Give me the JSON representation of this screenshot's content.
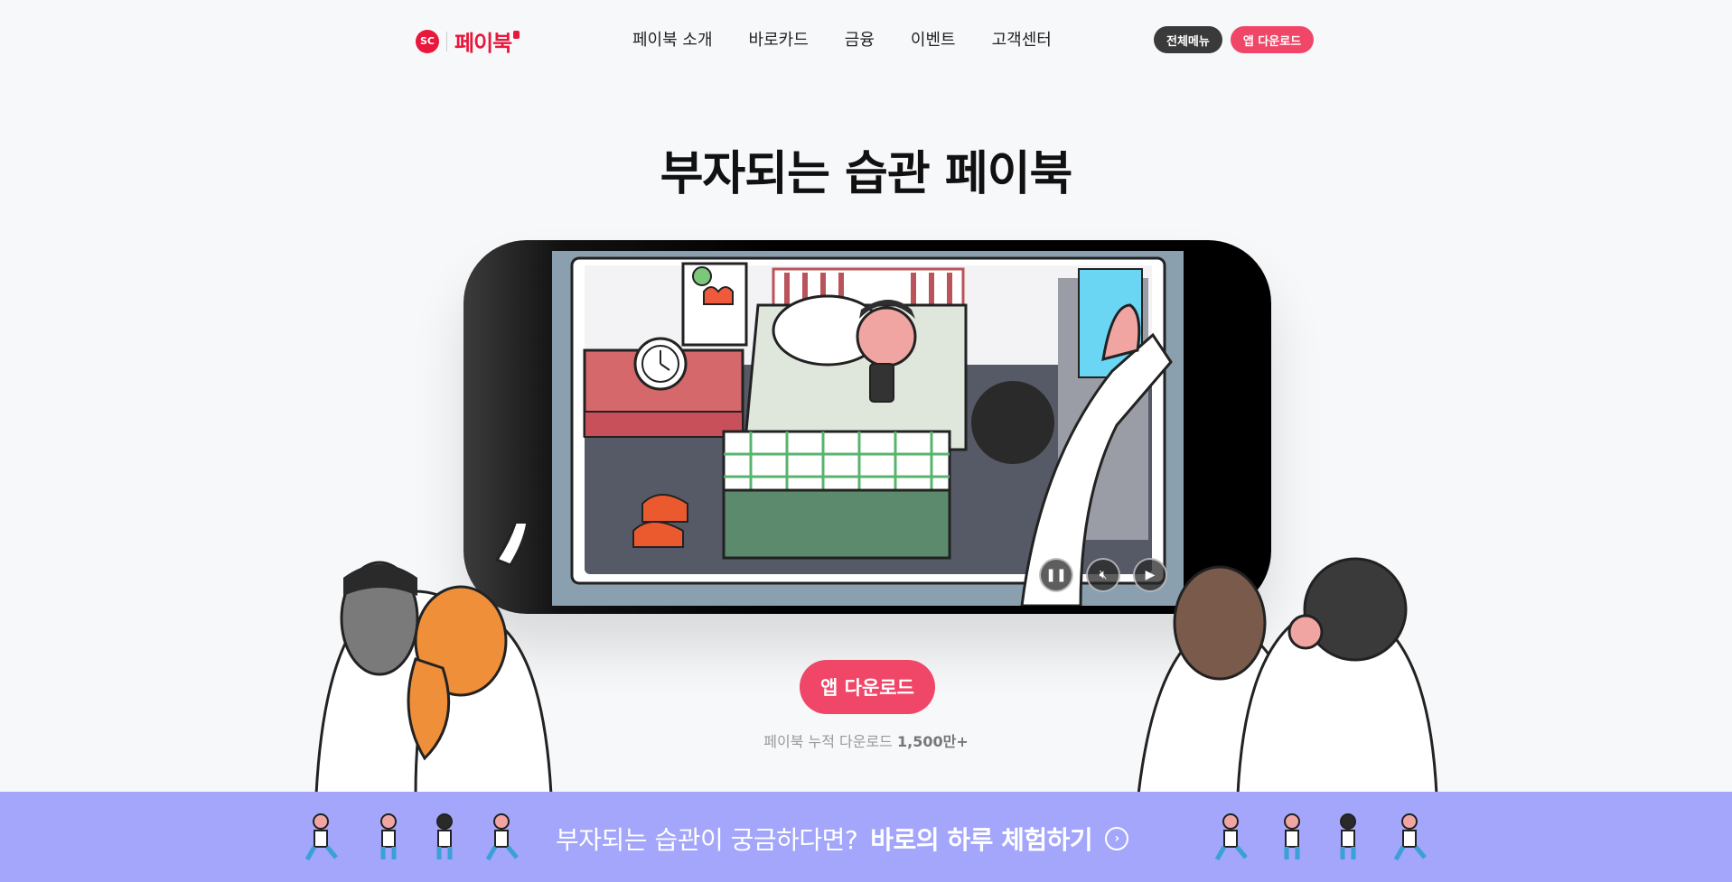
{
  "header": {
    "logo_badge": "SC",
    "logo_text": "페이북",
    "nav": [
      "페이북 소개",
      "바로카드",
      "금융",
      "이벤트",
      "고객센터"
    ],
    "all_menu_label": "전체메뉴",
    "app_download_label": "앱 다운로드"
  },
  "hero": {
    "headline_light": "부자되는 습관",
    "headline_bold": "페이북",
    "video_controls": [
      "pause-icon",
      "mute-icon",
      "play-icon"
    ],
    "cta_label": "앱 다운로드",
    "download_prefix": "페이북 누적 다운로드",
    "download_count": "1,500만+"
  },
  "banner": {
    "text_light": "부자되는 습관이 궁금하다면?",
    "text_bold": "바로의 하루 체험하기",
    "arrow_icon": "chevron-circle-right-icon"
  },
  "colors": {
    "brand": "#e8173b",
    "cta": "#f04768",
    "banner": "#a3a6fb"
  }
}
